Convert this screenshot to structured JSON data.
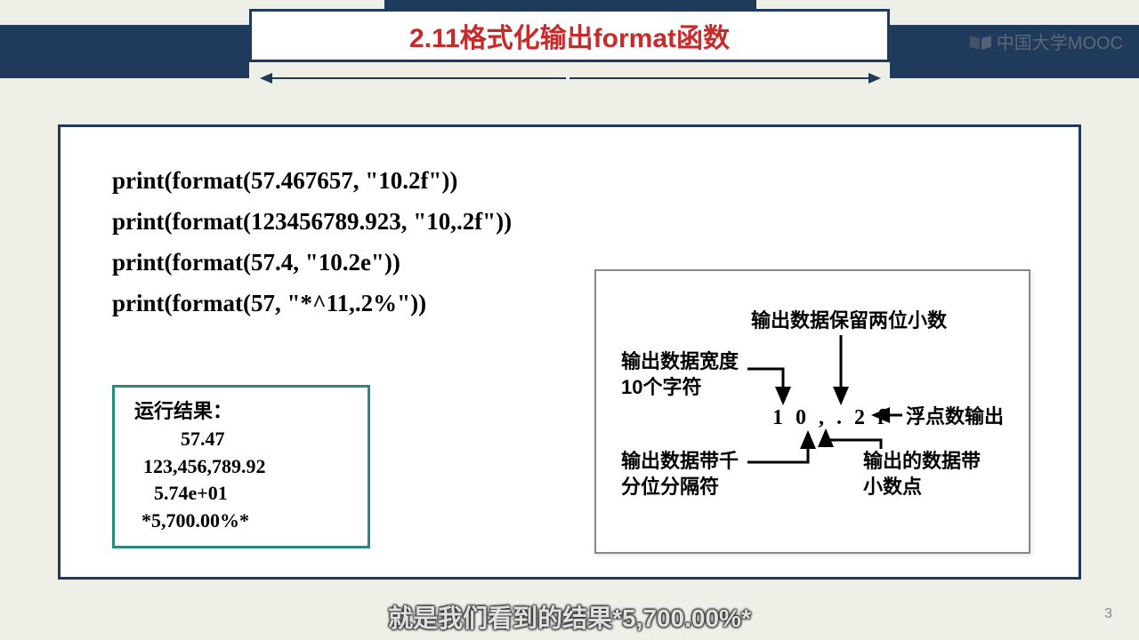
{
  "header": {
    "title": "2.11格式化输出format函数",
    "watermark": "中国大学MOOC"
  },
  "code": {
    "line1": "print(format(57.467657, \"10.2f\"))",
    "line2": "print(format(123456789.923, \"10,.2f\"))",
    "line3": "print(format(57.4, \"10.2e\"))",
    "line4": "print(format(57, \"*^11,.2%\"))"
  },
  "result": {
    "heading": "运行结果：",
    "r1": "57.47",
    "r2": "123,456,789.92",
    "r3": "5.74e+01",
    "r4": "*5,700.00%*"
  },
  "diagram": {
    "spec": "1 0 , . 2 f",
    "label_top": "输出数据保留两位小数",
    "label_left_top_1": "输出数据宽度",
    "label_left_top_2": "10个字符",
    "label_right": "浮点数输出",
    "label_left_bottom_1": "输出数据带千",
    "label_left_bottom_2": "分位分隔符",
    "label_right_bottom_1": "输出的数据带",
    "label_right_bottom_2": "小数点"
  },
  "subtitle": "就是我们看到的结果*5,700.00%*",
  "page_number": "3"
}
